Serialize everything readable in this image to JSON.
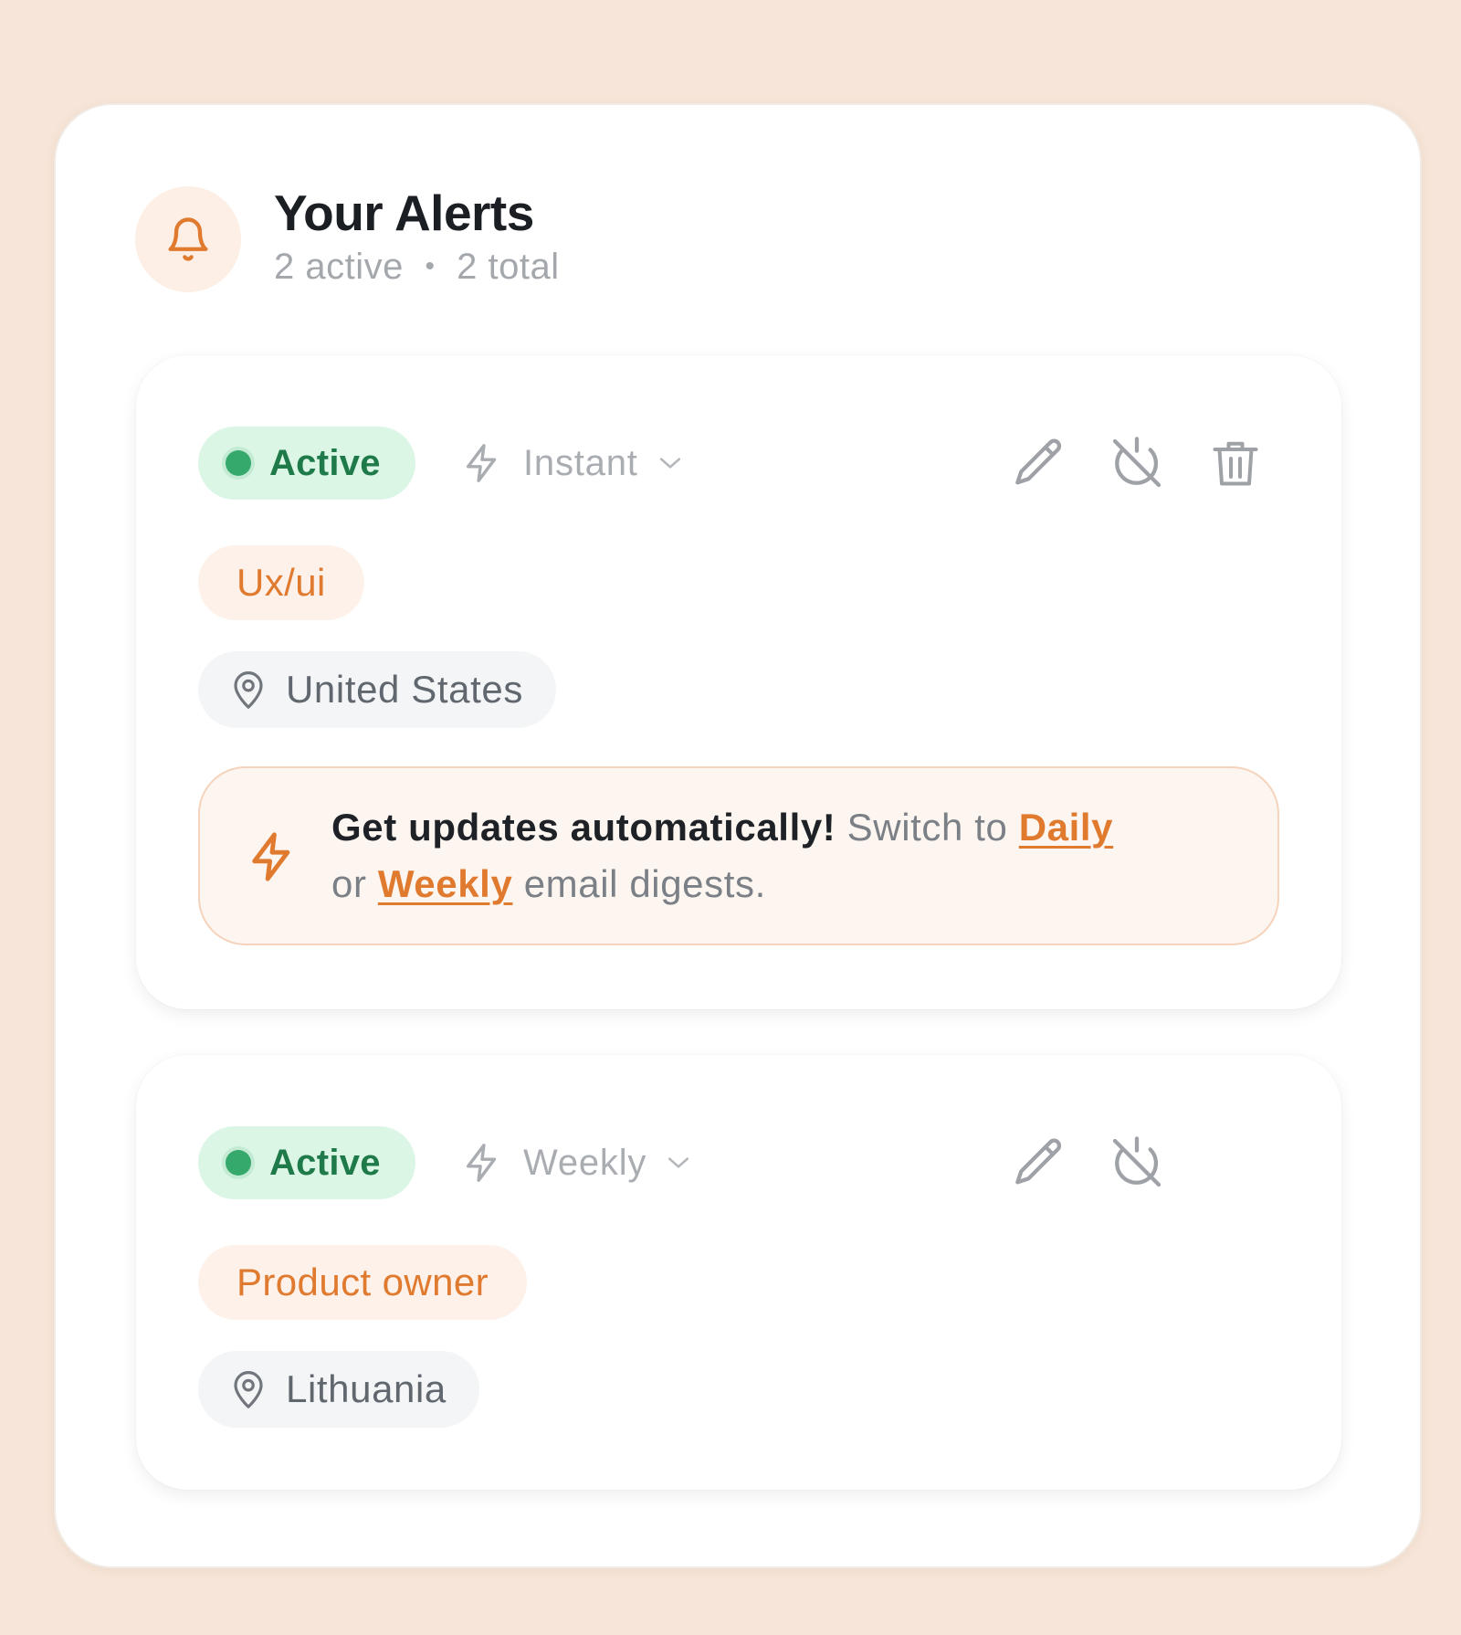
{
  "header": {
    "title": "Your Alerts",
    "subtitle_active": "2 active",
    "subtitle_sep": "•",
    "subtitle_total": "2 total",
    "icon": "bell-icon"
  },
  "alerts": [
    {
      "status": "Active",
      "frequency": "Instant",
      "tag": "Ux/ui",
      "location": "United States",
      "actions": [
        "pencil-icon",
        "power-off-icon",
        "trash-icon"
      ],
      "promo": {
        "strong": "Get updates automatically!",
        "text_before": " Switch to ",
        "link_daily": "Daily",
        "text_or": " or ",
        "link_weekly": "Weekly",
        "text_after": " email digests."
      }
    },
    {
      "status": "Active",
      "frequency": "Weekly",
      "tag": "Product owner",
      "location": "Lithuania",
      "actions": [
        "pencil-icon",
        "power-off-icon"
      ]
    }
  ],
  "colors": {
    "background": "#f6e5d8",
    "accent": "#e07a2f",
    "active_green": "#34a96b",
    "active_bg": "#dcf6e6"
  }
}
